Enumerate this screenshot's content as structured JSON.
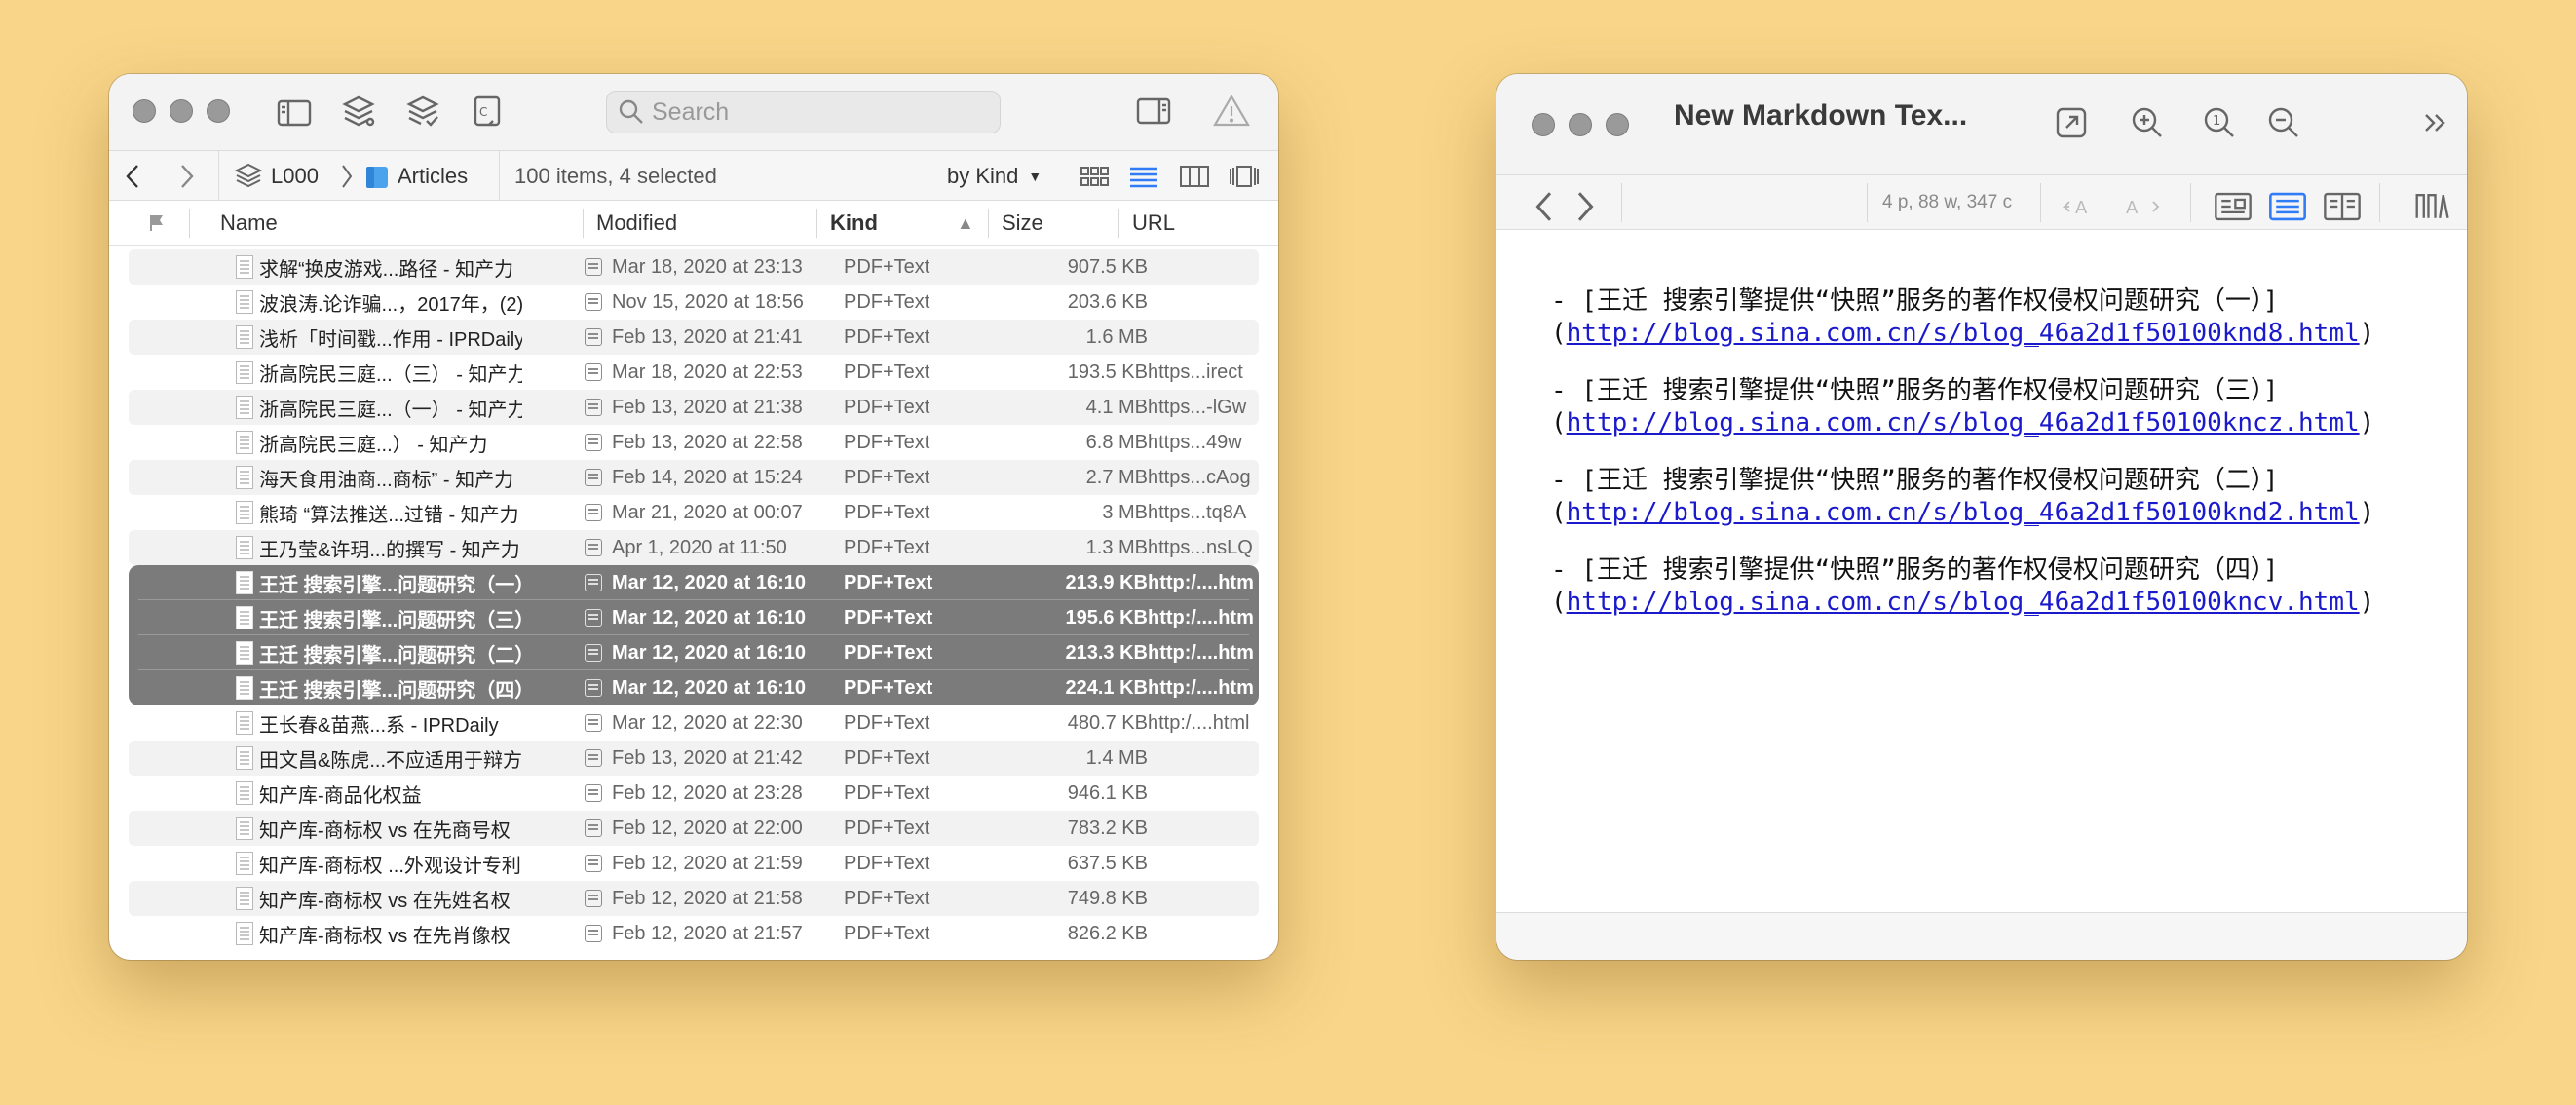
{
  "left_window": {
    "search_placeholder": "Search",
    "path": {
      "database": "L000",
      "group": "Articles"
    },
    "status": "100 items, 4 selected",
    "sort_mode": "by Kind",
    "columns": {
      "name": "Name",
      "modified": "Modified",
      "kind": "Kind",
      "size": "Size",
      "url": "URL"
    },
    "rows": [
      {
        "name": "求解“换皮游戏...路径 - 知产力",
        "modified": "Mar 18, 2020 at 23:13",
        "kind": "PDF+Text",
        "size": "907.5 KB",
        "url": "",
        "selected": false
      },
      {
        "name": "波浪涛.论诈骗...，2017年，(2)",
        "modified": "Nov 15, 2020 at 18:56",
        "kind": "PDF+Text",
        "size": "203.6 KB",
        "url": "",
        "selected": false
      },
      {
        "name": "浅析「时间戳...作用 - IPRDaily",
        "modified": "Feb 13, 2020 at 21:41",
        "kind": "PDF+Text",
        "size": "1.6 MB",
        "url": "",
        "selected": false
      },
      {
        "name": "浙高院民三庭...（三） - 知产力",
        "modified": "Mar 18, 2020 at 22:53",
        "kind": "PDF+Text",
        "size": "193.5 KB",
        "url": "https...irect",
        "selected": false
      },
      {
        "name": "浙高院民三庭...（一） - 知产力",
        "modified": "Feb 13, 2020 at 21:38",
        "kind": "PDF+Text",
        "size": "4.1 MB",
        "url": "https...-lGw",
        "selected": false
      },
      {
        "name": "浙高院民三庭...） - 知产力",
        "modified": "Feb 13, 2020 at 22:58",
        "kind": "PDF+Text",
        "size": "6.8 MB",
        "url": "https...49w",
        "selected": false
      },
      {
        "name": "海天食用油商...商标” - 知产力",
        "modified": "Feb 14, 2020 at 15:24",
        "kind": "PDF+Text",
        "size": "2.7 MB",
        "url": "https...cAog",
        "selected": false
      },
      {
        "name": "熊琦 “算法推送...过错 - 知产力",
        "modified": "Mar 21, 2020 at 00:07",
        "kind": "PDF+Text",
        "size": "3 MB",
        "url": "https...tq8A",
        "selected": false
      },
      {
        "name": "王乃莹&许玥...的撰写 - 知产力",
        "modified": "Apr 1, 2020 at 11:50",
        "kind": "PDF+Text",
        "size": "1.3 MB",
        "url": "https...nsLQ",
        "selected": false
      },
      {
        "name": "王迁 搜索引擎...问题研究（一）",
        "modified": "Mar 12, 2020 at 16:10",
        "kind": "PDF+Text",
        "size": "213.9 KB",
        "url": "http:/....html",
        "selected": true
      },
      {
        "name": "王迁 搜索引擎...问题研究（三）",
        "modified": "Mar 12, 2020 at 16:10",
        "kind": "PDF+Text",
        "size": "195.6 KB",
        "url": "http:/....html",
        "selected": true
      },
      {
        "name": "王迁 搜索引擎...问题研究（二）",
        "modified": "Mar 12, 2020 at 16:10",
        "kind": "PDF+Text",
        "size": "213.3 KB",
        "url": "http:/....html",
        "selected": true
      },
      {
        "name": "王迁 搜索引擎...问题研究（四）",
        "modified": "Mar 12, 2020 at 16:10",
        "kind": "PDF+Text",
        "size": "224.1 KB",
        "url": "http:/....html",
        "selected": true
      },
      {
        "name": "王长春&苗燕...系 - IPRDaily",
        "modified": "Mar 12, 2020 at 22:30",
        "kind": "PDF+Text",
        "size": "480.7 KB",
        "url": "http:/....html",
        "selected": false
      },
      {
        "name": "田文昌&陈虎...不应适用于辩方",
        "modified": "Feb 13, 2020 at 21:42",
        "kind": "PDF+Text",
        "size": "1.4 MB",
        "url": "",
        "selected": false
      },
      {
        "name": "知产库-商品化权益",
        "modified": "Feb 12, 2020 at 23:28",
        "kind": "PDF+Text",
        "size": "946.1 KB",
        "url": "",
        "selected": false
      },
      {
        "name": "知产库-商标权 vs 在先商号权",
        "modified": "Feb 12, 2020 at 22:00",
        "kind": "PDF+Text",
        "size": "783.2 KB",
        "url": "",
        "selected": false
      },
      {
        "name": "知产库-商标权 ...外观设计专利",
        "modified": "Feb 12, 2020 at 21:59",
        "kind": "PDF+Text",
        "size": "637.5 KB",
        "url": "",
        "selected": false
      },
      {
        "name": "知产库-商标权 vs 在先姓名权",
        "modified": "Feb 12, 2020 at 21:58",
        "kind": "PDF+Text",
        "size": "749.8 KB",
        "url": "",
        "selected": false
      },
      {
        "name": "知产库-商标权 vs 在先肖像权",
        "modified": "Feb 12, 2020 at 21:57",
        "kind": "PDF+Text",
        "size": "826.2 KB",
        "url": "",
        "selected": false
      }
    ]
  },
  "right_window": {
    "title": "New Markdown Tex...",
    "stats": "4 p, 88 w, 347 c",
    "lines": [
      {
        "prefix": "- [王迁  搜索引擎提供“快照”服务的著作权侵权问题研究（一）]",
        "open": "(",
        "link": "http://blog.sina.com.cn/s/blog_46a2d1f50100knd8.html",
        "close": ")"
      },
      {
        "prefix": "- [王迁  搜索引擎提供“快照”服务的著作权侵权问题研究（三）]",
        "open": "(",
        "link": "http://blog.sina.com.cn/s/blog_46a2d1f50100kncz.html",
        "close": ")"
      },
      {
        "prefix": "- [王迁  搜索引擎提供“快照”服务的著作权侵权问题研究（二）]",
        "open": "(",
        "link": "http://blog.sina.com.cn/s/blog_46a2d1f50100knd2.html",
        "close": ")"
      },
      {
        "prefix": "- [王迁  搜索引擎提供“快照”服务的著作权侵权问题研究（四）]",
        "open": "(",
        "link": "http://blog.sina.com.cn/s/blog_46a2d1f50100kncv.html",
        "close": ")"
      }
    ]
  },
  "colors": {
    "background": "#f8d588",
    "selection": "#7b7b7b",
    "link": "#1a1acc",
    "accent": "#2f7cf6"
  }
}
